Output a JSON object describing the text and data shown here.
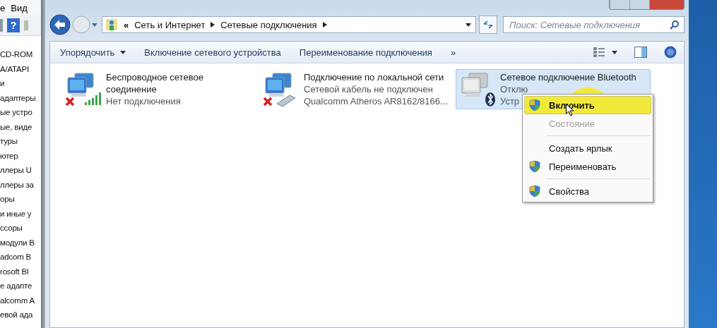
{
  "background_window": {
    "menu": [
      "е",
      "Вид"
    ],
    "help_glyph": "?",
    "tree_items": [
      "CD-ROM",
      "A/ATAPI",
      "и",
      "адаптеры",
      "ые устро",
      "ые, виде",
      "туры",
      "ютер",
      "ллеры U",
      "ллеры за",
      "оры",
      "и иные у",
      "ссоры",
      "модули B",
      "adcom B",
      "rosoft Bl",
      "е адапте",
      "alcomm A",
      "евой ада"
    ]
  },
  "address_bar": {
    "overflow": "«",
    "breadcrumbs": [
      "Сеть и Интернет",
      "Сетевые подключения"
    ]
  },
  "search": {
    "placeholder": "Поиск: Сетевые подключения"
  },
  "toolbar": {
    "items": [
      {
        "label": "Упорядочить",
        "dropdown": true
      },
      {
        "label": "Включение сетевого устройства",
        "dropdown": false
      },
      {
        "label": "Переименование подключения",
        "dropdown": false
      }
    ],
    "overflow": "»"
  },
  "connections": [
    {
      "kind": "wifi",
      "name": "Беспроводное сетевое соединение",
      "lines": [
        "Нет подключения"
      ],
      "selected": false
    },
    {
      "kind": "ethernet",
      "name": "Подключение по локальной сети",
      "lines": [
        "Сетевой кабель не подключен",
        "Qualcomm Atheros AR8162/8166..."
      ],
      "selected": false
    },
    {
      "kind": "bluetooth",
      "name": "Сетевое подключение Bluetooth",
      "lines": [
        "Отклю",
        "Устр"
      ],
      "selected": true
    }
  ],
  "context_menu": {
    "items": [
      {
        "kind": "item",
        "label": "Включить",
        "shield": true,
        "default": true,
        "disabled": false,
        "selected": true
      },
      {
        "kind": "item",
        "label": "Состояние",
        "shield": false,
        "default": false,
        "disabled": true,
        "selected": false
      },
      {
        "kind": "separator"
      },
      {
        "kind": "item",
        "label": "Создать ярлык",
        "shield": false,
        "default": false,
        "disabled": false,
        "selected": false
      },
      {
        "kind": "item",
        "label": "Переименовать",
        "shield": true,
        "default": false,
        "disabled": false,
        "selected": false
      },
      {
        "kind": "separator"
      },
      {
        "kind": "item",
        "label": "Свойства",
        "shield": true,
        "default": false,
        "disabled": false,
        "selected": false
      }
    ]
  }
}
